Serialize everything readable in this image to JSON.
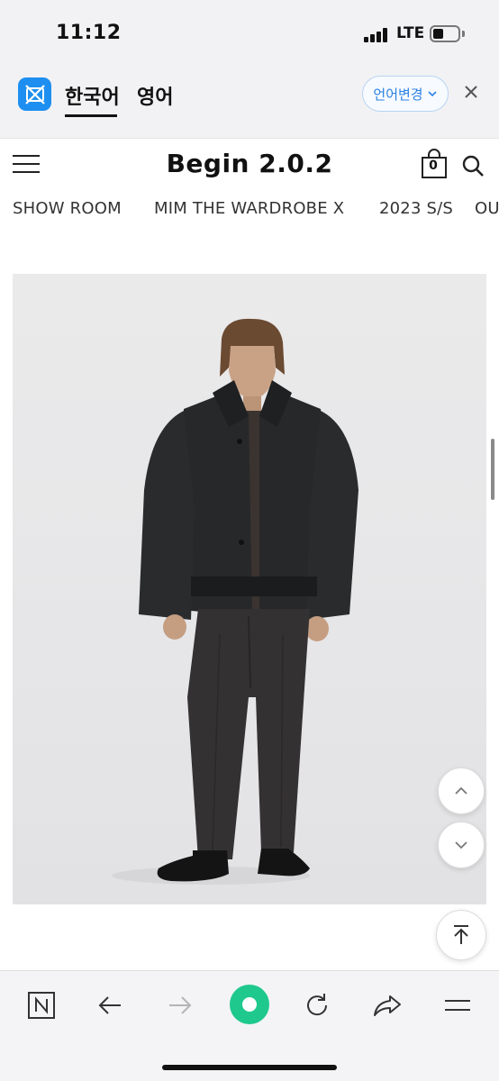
{
  "status_bar": {
    "time": "11:12",
    "network": "LTE"
  },
  "translate_bar": {
    "languages": [
      "한국어",
      "영어"
    ],
    "change_language_label": "언어변경"
  },
  "site": {
    "title": "Begin 2.0.2",
    "cart_count": "0",
    "nav": [
      "SHOW ROOM",
      "MIM THE WARDROBE X",
      "2023 S/S",
      "OU"
    ]
  },
  "colors": {
    "accent_blue": "#2a82e4",
    "translate_logo": "#1e8ff0",
    "refresh_green": "#1fc98e",
    "background": "#ffffff"
  },
  "icons": {
    "translate": "translate-logo-icon",
    "close": "close-icon",
    "menu": "hamburger-menu-icon",
    "cart": "shopping-bag-icon",
    "search": "search-icon",
    "scroll_up": "chevron-up-icon",
    "scroll_down": "chevron-down-icon",
    "scroll_top": "arrow-to-top-icon",
    "toolbar": [
      "naver-n-icon",
      "back-arrow-icon",
      "forward-arrow-icon",
      "green-dot-icon",
      "refresh-icon",
      "share-icon",
      "menu-icon"
    ]
  }
}
